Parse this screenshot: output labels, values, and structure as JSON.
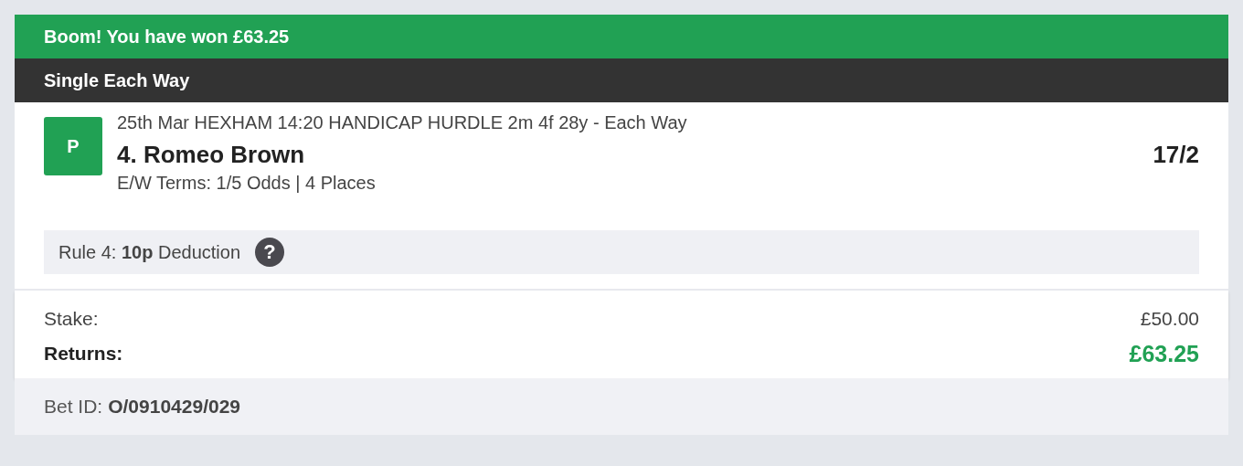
{
  "win_banner": "Boom! You have won £63.25",
  "bet_type": "Single Each Way",
  "selection": {
    "result_badge": "P",
    "event": "25th Mar HEXHAM 14:20 HANDICAP HURDLE 2m 4f 28y - Each Way",
    "runner": "4. Romeo Brown",
    "odds": "17/2",
    "terms": "E/W Terms: 1/5 Odds | 4 Places"
  },
  "rule4": {
    "text": "Rule 4: **10p** Deduction",
    "help": "?"
  },
  "totals": [
    {
      "label": "Stake:",
      "value": "£50.00",
      "kind": "plain"
    },
    {
      "label": "Returns:",
      "value": "£63.25",
      "kind": "highlight"
    }
  ],
  "bet_id": {
    "label": "Bet ID:",
    "value": "O/0910429/029"
  }
}
